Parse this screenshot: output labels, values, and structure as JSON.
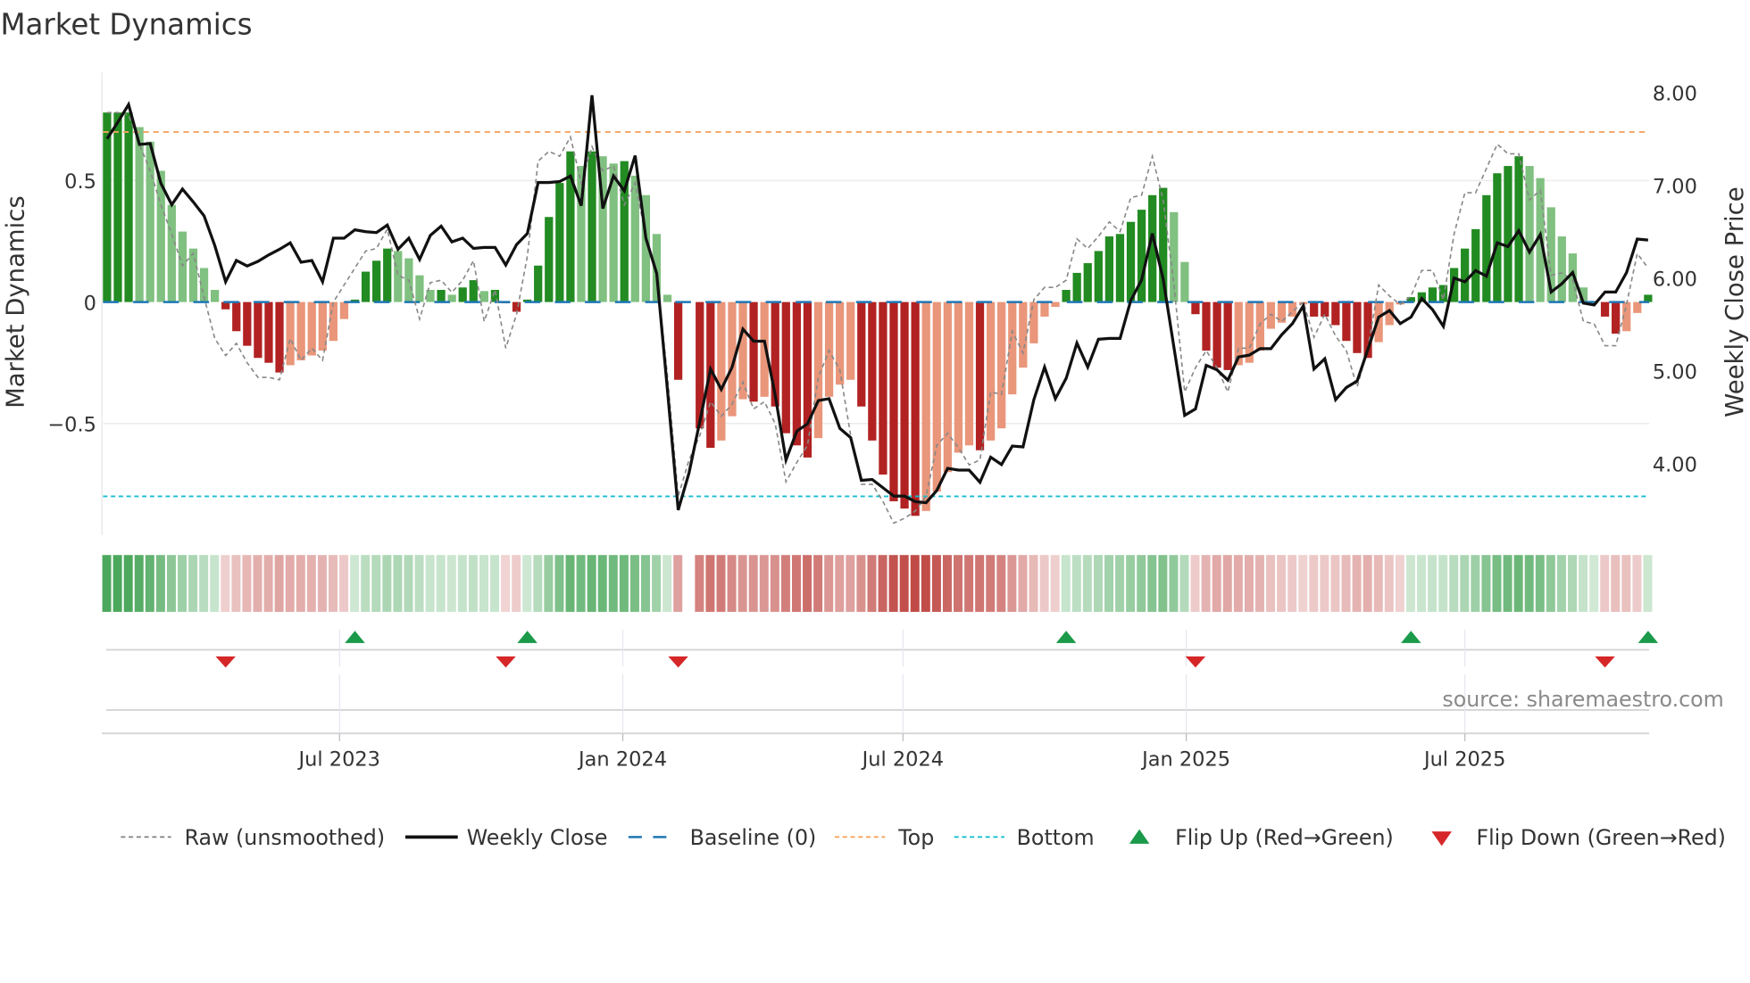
{
  "chart_data": {
    "type": "bar",
    "title": "Market Dynamics",
    "ylabel": "Market Dynamics",
    "y2label": "Weekly Close Price",
    "start_week": "2023-01-31",
    "interval_days": 7,
    "ylim": [
      -0.96,
      0.945
    ],
    "y2lim": [
      3.23,
      8.22
    ],
    "yticks": [
      {
        "value": 0.5,
        "label": "0.5"
      },
      {
        "value": 0,
        "label": "0"
      },
      {
        "value": -0.5,
        "label": "−0.5"
      }
    ],
    "y2ticks": [
      {
        "value": 8,
        "label": "8.00"
      },
      {
        "value": 7,
        "label": "7.00"
      },
      {
        "value": 6,
        "label": "6.00"
      },
      {
        "value": 5,
        "label": "5.00"
      },
      {
        "value": 4,
        "label": "4.00"
      }
    ],
    "xticks": [
      {
        "date": "2023-07-01",
        "label": "Jul 2023"
      },
      {
        "date": "2024-01-01",
        "label": "Jan 2024"
      },
      {
        "date": "2024-07-01",
        "label": "Jul 2024"
      },
      {
        "date": "2025-01-01",
        "label": "Jan 2025"
      },
      {
        "date": "2025-07-01",
        "label": "Jul 2025"
      }
    ],
    "top_level": 0.7,
    "bottom_level": -0.8,
    "baseline": 0,
    "grid": true,
    "legend_position": "bottom",
    "colors": {
      "green_strong": "#228B22",
      "green_weak": "#80C080",
      "red_strong": "#B22222",
      "red_weak": "#E9967A",
      "raw": "#888888",
      "close": "#111111",
      "baseline": "#1f77b4",
      "top": "#F4A460",
      "bottom": "#17BECF",
      "flip_up": "#1A9A4A",
      "flip_down": "#D62728"
    },
    "momentum": [
      0.78,
      0.78,
      0.78,
      0.72,
      0.66,
      0.54,
      0.4,
      0.29,
      0.22,
      0.14,
      0.05,
      -0.03,
      -0.12,
      -0.18,
      -0.23,
      -0.25,
      -0.29,
      -0.26,
      -0.24,
      -0.22,
      -0.2,
      -0.16,
      -0.07,
      0.01,
      0.125,
      0.17,
      0.22,
      0.21,
      0.18,
      0.11,
      0.05,
      0.05,
      0.03,
      0.06,
      0.09,
      0.045,
      0.05,
      -0.005,
      -0.04,
      0.01,
      0.15,
      0.35,
      0.49,
      0.62,
      0.56,
      0.62,
      0.6,
      0.57,
      0.58,
      0.52,
      0.44,
      0.28,
      0.03,
      -0.32,
      null,
      -0.52,
      -0.6,
      -0.57,
      -0.47,
      -0.4,
      -0.41,
      -0.39,
      -0.43,
      -0.54,
      -0.59,
      -0.64,
      -0.56,
      -0.39,
      -0.34,
      -0.32,
      -0.43,
      -0.57,
      -0.71,
      -0.82,
      -0.85,
      -0.88,
      -0.86,
      -0.78,
      -0.7,
      -0.62,
      -0.59,
      -0.61,
      -0.57,
      -0.52,
      -0.38,
      -0.27,
      -0.17,
      -0.06,
      -0.02,
      0.05,
      0.12,
      0.16,
      0.21,
      0.27,
      0.28,
      0.33,
      0.38,
      0.44,
      0.47,
      0.37,
      0.165,
      -0.05,
      -0.2,
      -0.27,
      -0.28,
      -0.26,
      -0.25,
      -0.2,
      -0.11,
      -0.085,
      -0.06,
      -0.01,
      -0.06,
      -0.06,
      -0.095,
      -0.16,
      -0.21,
      -0.23,
      -0.165,
      -0.095,
      -0.01,
      0.02,
      0.04,
      0.06,
      0.07,
      0.14,
      0.22,
      0.3,
      0.44,
      0.53,
      0.56,
      0.6,
      0.56,
      0.51,
      0.39,
      0.27,
      0.2,
      0.06,
      0.005,
      -0.06,
      -0.13,
      -0.12,
      -0.045,
      0.03
    ],
    "raw": [
      0.78,
      0.78,
      0.77,
      0.65,
      0.54,
      0.4,
      0.28,
      0.15,
      0.2,
      0.02,
      -0.15,
      -0.22,
      -0.17,
      -0.25,
      -0.31,
      -0.31,
      -0.32,
      -0.15,
      -0.24,
      -0.19,
      -0.24,
      0.0,
      0.07,
      0.14,
      0.21,
      0.22,
      0.3,
      0.11,
      0.09,
      -0.07,
      0.08,
      0.09,
      0.04,
      0.09,
      0.17,
      -0.08,
      0.05,
      -0.19,
      -0.05,
      0.19,
      0.58,
      0.62,
      0.6,
      0.68,
      0.49,
      0.64,
      0.54,
      0.56,
      0.4,
      0.49,
      0.27,
      0.12,
      -0.3,
      -0.8,
      -0.65,
      -0.55,
      -0.41,
      -0.47,
      -0.42,
      -0.33,
      -0.44,
      -0.41,
      -0.5,
      -0.74,
      -0.66,
      -0.59,
      -0.31,
      -0.2,
      -0.28,
      -0.55,
      -0.75,
      -0.75,
      -0.82,
      -0.91,
      -0.89,
      -0.86,
      -0.8,
      -0.59,
      -0.54,
      -0.6,
      -0.67,
      -0.65,
      -0.37,
      -0.38,
      -0.12,
      -0.21,
      0.01,
      0.06,
      0.06,
      0.09,
      0.26,
      0.22,
      0.27,
      0.33,
      0.29,
      0.43,
      0.44,
      0.6,
      0.42,
      0.07,
      -0.37,
      -0.27,
      -0.2,
      -0.27,
      -0.37,
      -0.19,
      -0.19,
      -0.09,
      -0.05,
      -0.08,
      -0.04,
      0.0,
      -0.145,
      -0.05,
      -0.14,
      -0.2,
      -0.35,
      -0.19,
      0.07,
      0.025,
      -0.01,
      0.025,
      0.13,
      0.13,
      0.01,
      0.28,
      0.45,
      0.45,
      0.55,
      0.65,
      0.61,
      0.61,
      0.42,
      0.46,
      0.11,
      0.12,
      0.09,
      -0.08,
      -0.09,
      -0.18,
      -0.18,
      -0.01,
      0.2,
      0.14
    ],
    "close": [
      7.5,
      7.68,
      7.87,
      7.44,
      7.45,
      7.02,
      6.79,
      6.96,
      6.82,
      6.67,
      6.35,
      5.96,
      6.19,
      6.13,
      6.18,
      6.25,
      6.31,
      6.38,
      6.17,
      6.19,
      5.96,
      6.43,
      6.43,
      6.52,
      6.5,
      6.49,
      6.57,
      6.31,
      6.43,
      6.2,
      6.46,
      6.56,
      6.39,
      6.43,
      6.32,
      6.33,
      6.33,
      6.14,
      6.36,
      6.48,
      7.03,
      7.03,
      7.04,
      7.1,
      6.78,
      7.97,
      6.75,
      7.1,
      6.94,
      7.32,
      6.43,
      6.05,
      4.8,
      3.5,
      3.9,
      4.45,
      5.02,
      4.8,
      5.04,
      5.45,
      5.32,
      5.32,
      4.74,
      4.04,
      4.35,
      4.43,
      4.68,
      4.7,
      4.38,
      4.28,
      3.82,
      3.83,
      3.74,
      3.65,
      3.65,
      3.59,
      3.58,
      3.71,
      3.95,
      3.93,
      3.93,
      3.8,
      4.07,
      3.99,
      4.19,
      4.18,
      4.69,
      5.04,
      4.7,
      4.92,
      5.3,
      5.04,
      5.34,
      5.35,
      5.35,
      5.76,
      5.98,
      6.48,
      5.99,
      5.25,
      4.52,
      4.59,
      5.06,
      5.01,
      4.9,
      5.15,
      5.17,
      5.24,
      5.24,
      5.39,
      5.51,
      5.7,
      5.02,
      5.13,
      4.69,
      4.82,
      4.89,
      5.23,
      5.58,
      5.65,
      5.51,
      5.58,
      5.78,
      5.66,
      5.48,
      6.0,
      5.96,
      6.08,
      6.02,
      6.38,
      6.34,
      6.51,
      6.28,
      6.47,
      5.85,
      5.94,
      6.06,
      5.73,
      5.71,
      5.85,
      5.85,
      6.06,
      6.42,
      6.41
    ]
  },
  "legend": {
    "raw": "Raw (unsmoothed)",
    "close": "Weekly Close",
    "baseline": "Baseline (0)",
    "top": "Top",
    "bottom": "Bottom",
    "flip_up": "Flip Up (Red→Green)",
    "flip_down": "Flip Down (Green→Red)"
  },
  "source": "source: sharemaestro.com"
}
